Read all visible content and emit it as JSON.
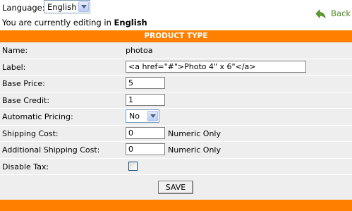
{
  "language": {
    "label": "Language:",
    "selected": "English"
  },
  "editing": {
    "prefix": "You are currently editing in ",
    "language": "English"
  },
  "back_link": {
    "label": "Back",
    "icon": "back-arrow-icon",
    "color": "#4d8a1f"
  },
  "header": {
    "title": "PRODUCT TYPE",
    "color": "#ff8000"
  },
  "form": {
    "name": {
      "label": "Name:",
      "value": "photoa"
    },
    "label_field": {
      "label": "Label:",
      "value": "<a href=\"#\">Photo 4\" x 6\"</a>"
    },
    "base_price": {
      "label": "Base Price:",
      "value": "5"
    },
    "base_credit": {
      "label": "Base Credit:",
      "value": "1"
    },
    "automatic_pricing": {
      "label": "Automatic Pricing:",
      "selected": "No"
    },
    "shipping_cost": {
      "label": "Shipping Cost:",
      "value": "0",
      "note": "Numeric Only"
    },
    "additional_shipping_cost": {
      "label": "Additional Shipping Cost:",
      "value": "0",
      "note": "Numeric Only"
    },
    "disable_tax": {
      "label": "Disable Tax:",
      "checked": false
    },
    "save_label": "SAVE"
  }
}
